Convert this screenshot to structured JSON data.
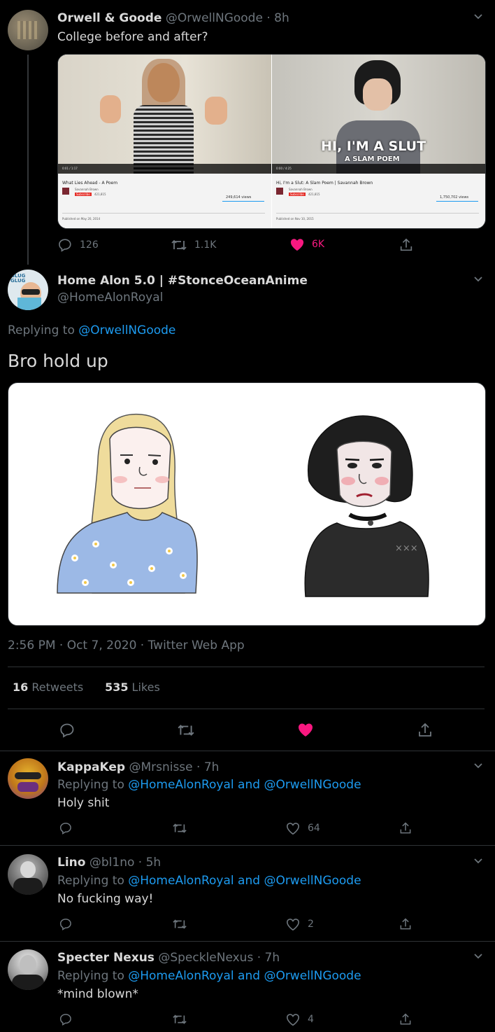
{
  "tweet1": {
    "name": "Orwell & Goode",
    "handle": "@OrwellNGoode · 8h",
    "text": "College before and after?",
    "media": {
      "left": {
        "video_title": "What Lies Ahead - A Poem",
        "channel": "Savannah Brown",
        "views": "249,614 views",
        "published": "Published on May 20, 2014",
        "time": "0:01 / 1:17",
        "subscribe": "Subscribe",
        "subs": "421,815"
      },
      "right": {
        "video_title": "Hi, I'm a Slut: A Slam Poem | Savannah Brown",
        "channel": "Savannah Brown",
        "views": "1,750,702 views",
        "published": "Published on Nov 10, 2015",
        "time": "0:00 / 4:25",
        "overlay": "HI, I'M A SLUT",
        "overlay_sub": "A SLAM POEM",
        "subscribe": "Subscribe",
        "subs": "421,815"
      }
    },
    "replies": "126",
    "retweets": "1.1K",
    "likes": "6K"
  },
  "main": {
    "name": "Home Alon 5.0 | #StonceOceanAnime",
    "handle": "@HomeAlonRoyal",
    "replying_prefix": "Replying to ",
    "replying_to": "@OrwellNGoode",
    "text": "Bro hold up",
    "timestamp": "2:56 PM · Oct 7, 2020 · Twitter Web App",
    "retweets_count": "16",
    "retweets_label": " Retweets",
    "likes_count": "535",
    "likes_label": " Likes"
  },
  "replies": [
    {
      "name": "KappaKep",
      "handle": "@Mrsnisse · 7h",
      "replying_prefix": "Replying to ",
      "to1": "@HomeAlonRoyal",
      "and": " and ",
      "to2": "@OrwellNGoode",
      "text": "Holy shit",
      "likes": "64"
    },
    {
      "name": "Lino",
      "handle": "@bl1no · 5h",
      "replying_prefix": "Replying to ",
      "to1": "@HomeAlonRoyal",
      "and": " and ",
      "to2": "@OrwellNGoode",
      "text": "No fucking way!",
      "likes": "2"
    },
    {
      "name": "Specter Nexus",
      "handle": "@SpeckleNexus · 7h",
      "replying_prefix": "Replying to ",
      "to1": "@HomeAlonRoyal",
      "and": " and ",
      "to2": "@OrwellNGoode",
      "text": "*mind blown*",
      "likes": "4"
    }
  ],
  "colors": {
    "background": "#000000",
    "link": "#1d9bf0",
    "like": "#f91880",
    "muted": "#6e767d"
  }
}
